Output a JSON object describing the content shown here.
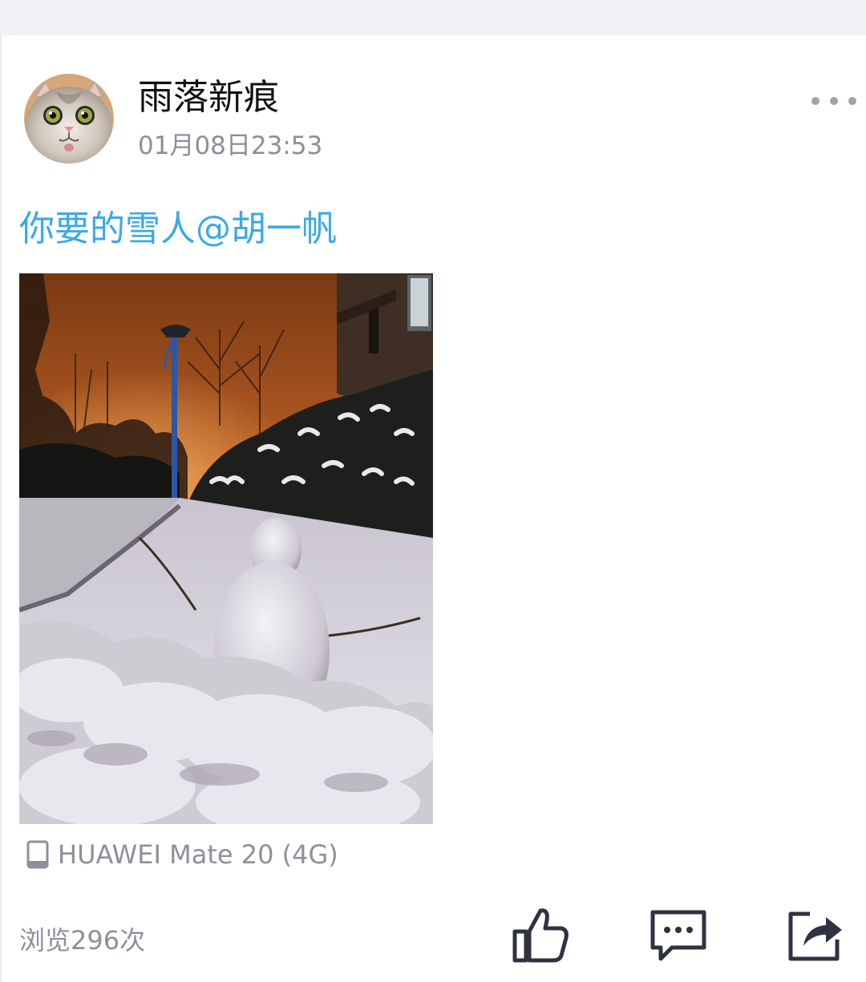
{
  "post": {
    "author": "雨落新痕",
    "timestamp": "01月08日23:53",
    "text": "你要的雪人@胡一帆",
    "device": "HUAWEI Mate 20 (4G)",
    "views": "浏览296次"
  },
  "icons": {
    "more": "more-dots-icon",
    "device": "phone-icon",
    "like": "thumbs-up-icon",
    "comment": "comment-icon",
    "share": "share-icon"
  },
  "colors": {
    "mention_text": "#3aa9e8",
    "secondary_text": "#8c9099",
    "icon": "#2f3340"
  }
}
